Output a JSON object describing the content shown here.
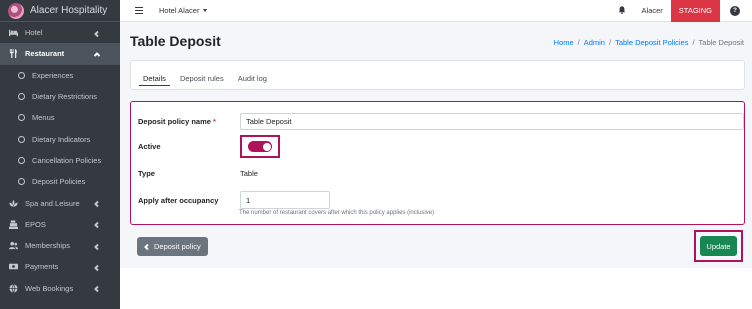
{
  "brand": {
    "name": "Alacer Hospitality"
  },
  "sidebar": {
    "items": [
      {
        "label": "Hotel",
        "icon": "bed-icon",
        "chevron": "left"
      },
      {
        "label": "Restaurant",
        "icon": "utensils-icon",
        "chevron": "down",
        "active": true
      },
      {
        "label": "Experiences",
        "sub": true
      },
      {
        "label": "Dietary Restrictions",
        "sub": true
      },
      {
        "label": "Menus",
        "sub": true
      },
      {
        "label": "Dietary Indicators",
        "sub": true
      },
      {
        "label": "Cancellation Policies",
        "sub": true
      },
      {
        "label": "Deposit Policies",
        "sub": true
      },
      {
        "label": "Spa and Leisure",
        "icon": "spa-icon",
        "chevron": "left"
      },
      {
        "label": "EPOS",
        "icon": "cash-register-icon",
        "chevron": "left"
      },
      {
        "label": "Memberships",
        "icon": "users-icon",
        "chevron": "left"
      },
      {
        "label": "Payments",
        "icon": "money-icon",
        "chevron": "left"
      },
      {
        "label": "Web Bookings",
        "icon": "globe-icon",
        "chevron": "left"
      }
    ]
  },
  "topbar": {
    "hotel": "Hotel Alacer",
    "user": "Alacer",
    "environment": "STAGING",
    "help": "?"
  },
  "page": {
    "title": "Table Deposit",
    "breadcrumb": [
      "Home",
      "Admin",
      "Table Deposit Policies",
      "Table Deposit"
    ]
  },
  "tabs": [
    "Details",
    "Deposit rules",
    "Audit log"
  ],
  "form": {
    "name_label": "Deposit policy name",
    "name_value": "Table Deposit",
    "active_label": "Active",
    "active_value": true,
    "type_label": "Type",
    "type_value": "Table",
    "occupancy_label": "Apply after occupancy",
    "occupancy_value": "1",
    "occupancy_help": "The number of restaurant covers after which this policy applies (inclusive)"
  },
  "footer": {
    "back_label": "Deposit policy",
    "update_label": "Update"
  },
  "colors": {
    "sidebar_bg": "#343a40",
    "accent": "#b0125b",
    "staging": "#dc3545",
    "update": "#198754",
    "secondary": "#6c757d",
    "link": "#007bff"
  }
}
